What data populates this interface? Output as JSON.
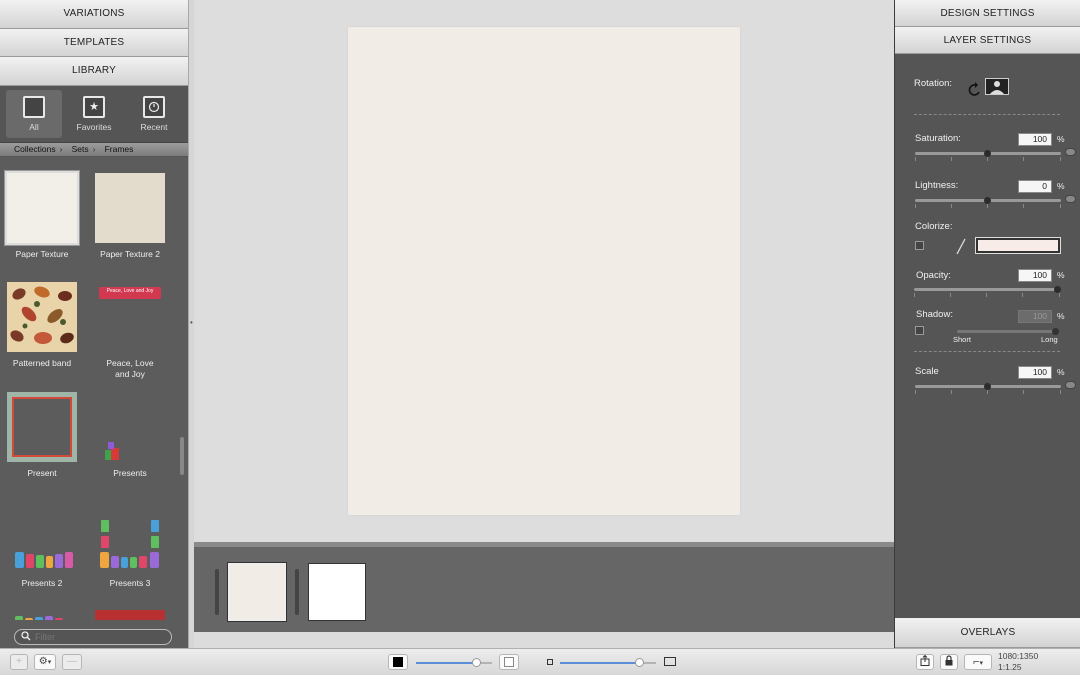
{
  "left_panel": {
    "variations_label": "VARIATIONS",
    "templates_label": "TEMPLATES",
    "library_label": "LIBRARY",
    "filters": [
      {
        "label": "All",
        "icon": "square-icon",
        "active": true
      },
      {
        "label": "Favorites",
        "icon": "star-icon",
        "active": false
      },
      {
        "label": "Recent",
        "icon": "clock-icon",
        "active": false
      }
    ],
    "breadcrumb": [
      "Collections",
      "Sets",
      "Frames"
    ],
    "items": [
      {
        "label": "Paper Texture",
        "selected": true
      },
      {
        "label": "Paper Texture 2"
      },
      {
        "label": "Patterned band"
      },
      {
        "label": "Peace, Love and Joy",
        "banner_text": "Peace, Love and Joy"
      },
      {
        "label": "Present"
      },
      {
        "label": "Presents"
      },
      {
        "label": "Presents 2"
      },
      {
        "label": "Presents 3"
      }
    ],
    "filter_placeholder": "Filter"
  },
  "right_panel": {
    "design_settings_label": "DESIGN SETTINGS",
    "layer_settings_label": "LAYER SETTINGS",
    "rotation_label": "Rotation:",
    "saturation_label": "Saturation:",
    "saturation_value": "100",
    "lightness_label": "Lightness:",
    "lightness_value": "0",
    "colorize_label": "Colorize:",
    "colorize_color": "#f7ece8",
    "opacity_label": "Opacity:",
    "opacity_value": "100",
    "shadow_label": "Shadow:",
    "shadow_value": "100",
    "shadow_short_label": "Short",
    "shadow_long_label": "Long",
    "scale_label": "Scale",
    "scale_value": "100",
    "percent": "%",
    "overlays_label": "OVERLAYS"
  },
  "toolbar": {
    "add_label": "+",
    "remove_label": "—",
    "dimensions": "1080:1350",
    "ratio": "1:1.25"
  },
  "colors": {
    "page_background": "#f1ede6",
    "accent_blue": "#5a8fd8"
  }
}
